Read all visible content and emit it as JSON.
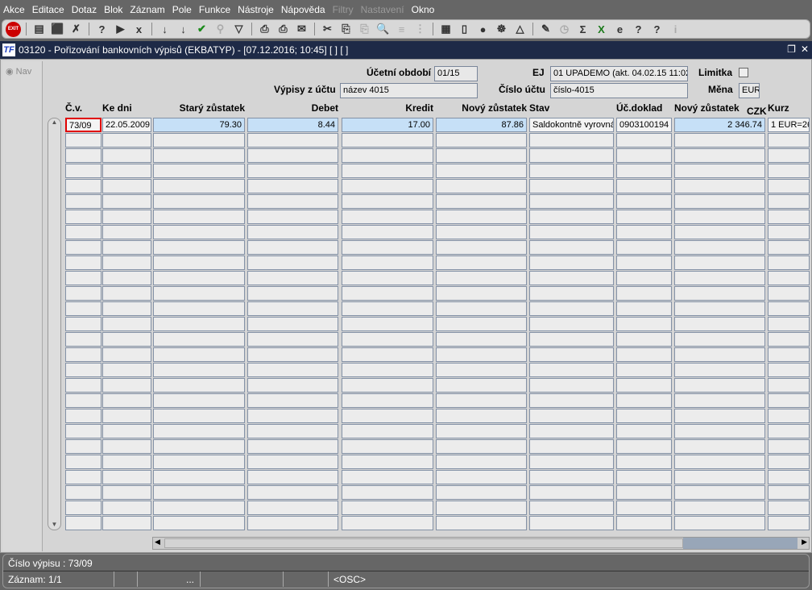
{
  "menu": [
    "Akce",
    "Editace",
    "Dotaz",
    "Blok",
    "Záznam",
    "Pole",
    "Funkce",
    "Nástroje",
    "Nápověda",
    "Filtry",
    "Nastavení",
    "Okno"
  ],
  "menu_disabled": [
    "Filtry",
    "Nastavení"
  ],
  "toolbar": {
    "exit_label": "EXIT",
    "icons": [
      "insert-record-icon",
      "save-record-icon",
      "delete-record-icon",
      "query-icon",
      "execute-query-icon",
      "cancel-query-icon",
      "sort-asc-icon",
      "sort-desc-icon",
      "checkmark-icon",
      "wrench-icon",
      "filter-icon",
      "print-icon",
      "print-setup-icon",
      "mail-icon",
      "cut-icon",
      "copy-icon",
      "paste-icon",
      "search-icon",
      "list-icon",
      "tree-icon",
      "calculator-icon",
      "document-icon",
      "globe-icon",
      "ship-wheel-icon",
      "warning-icon",
      "notes-icon",
      "clock-icon",
      "sum-icon",
      "excel-icon",
      "ie-icon",
      "help-icon",
      "context-help-icon",
      "info-icon"
    ]
  },
  "window": {
    "title": "03120 - Pořizování bankovních výpisů (EKBATYP) - [07.12.2016; 10:45]  [ ] [ ]",
    "logo": "TF"
  },
  "nav": {
    "label": "Nav"
  },
  "form": {
    "ucetni_obdobi_label": "Účetní období",
    "ucetni_obdobi": "01/15",
    "ej_label": "EJ",
    "ej": "01 UPADEMO (akt. 04.02.15 11:02)",
    "limitka_label": "Limitka",
    "limitka_checked": false,
    "vypisy_label": "Výpisy z účtu",
    "vypisy": "název 4015",
    "cislo_uctu_label": "Číslo účtu",
    "cislo_uctu": "číslo-4015",
    "mena_label": "Měna",
    "mena": "EUR"
  },
  "columns": [
    "Č.v.",
    "Ke dni",
    "Starý zůstatek",
    "Debet",
    "Kredit",
    "Nový zůstatek",
    "Stav",
    "Úč.doklad",
    "Nový zůstatek",
    "Kurz"
  ],
  "czk_label": "CZK",
  "rows": [
    [
      "73/09",
      "22.05.2009",
      "79.30",
      "8.44",
      "17.00",
      "87.86",
      "Saldokontně vyrovná",
      "0903100194",
      "2 346.74",
      "1 EUR=26"
    ]
  ],
  "status": {
    "line1": "Číslo výpisu : 73/09",
    "record": "Záznam: 1/1",
    "ellipsis": "...",
    "mode": "<OSC>"
  }
}
